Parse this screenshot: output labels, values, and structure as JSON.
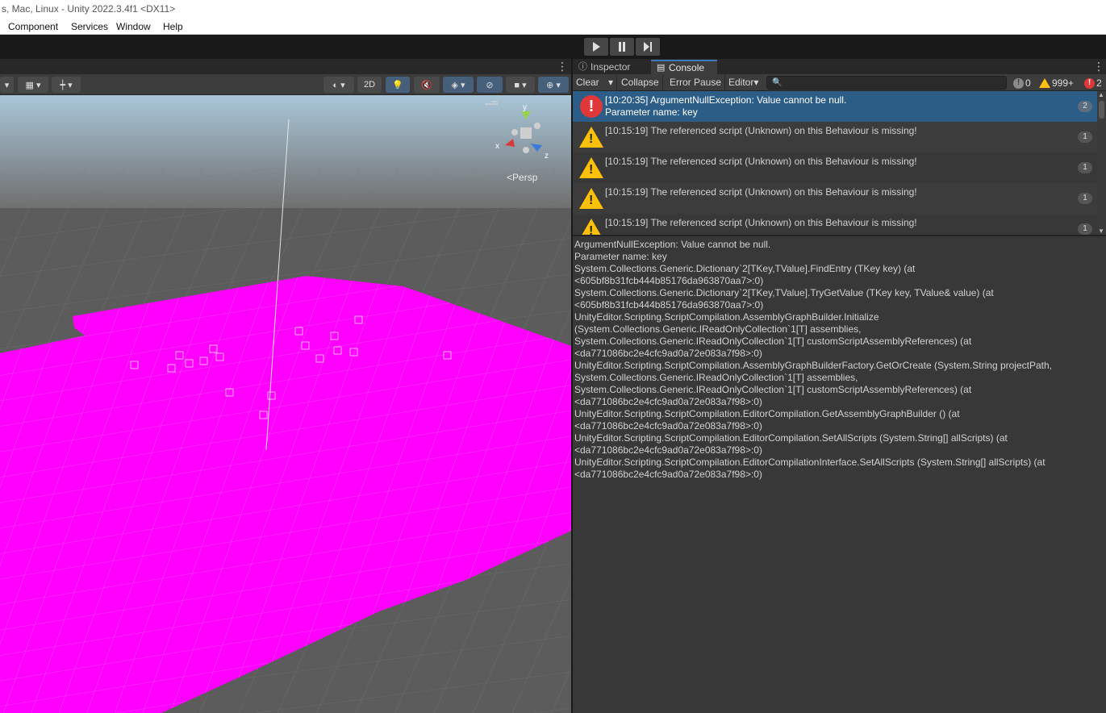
{
  "window": {
    "title": "s, Mac, Linux - Unity 2022.3.4f1 <DX11>"
  },
  "menu": {
    "items": [
      "Component",
      "Services",
      "Window",
      "Help"
    ]
  },
  "playbar": {
    "play_icon": "play-icon",
    "pause_icon": "pause-icon",
    "step_icon": "step-icon"
  },
  "scene": {
    "toolbar": {
      "mode_2d": "2D"
    },
    "gizmo": {
      "y": "y",
      "x": "x",
      "z": "z",
      "projection": "Persp"
    },
    "colors": {
      "ground": "#5c5c5c",
      "plane": "#ff00ff"
    }
  },
  "console_panel": {
    "tabs": [
      {
        "label": "Inspector",
        "icon": "info-icon"
      },
      {
        "label": "Console",
        "icon": "console-icon"
      }
    ],
    "toolbar": {
      "clear": "Clear",
      "collapse": "Collapse",
      "error_pause": "Error Pause",
      "editor": "Editor",
      "search_placeholder": "",
      "info_count": "0",
      "warning_count": "999+",
      "error_count": "2"
    },
    "entries": [
      {
        "type": "error",
        "line1": "[10:20:35] ArgumentNullException: Value cannot be null.",
        "line2": "Parameter name: key",
        "count": "2"
      },
      {
        "type": "warning",
        "line1": "[10:15:19] The referenced script (Unknown) on this Behaviour is missing!",
        "line2": "",
        "count": "1"
      },
      {
        "type": "warning",
        "line1": "[10:15:19] The referenced script (Unknown) on this Behaviour is missing!",
        "line2": "",
        "count": "1"
      },
      {
        "type": "warning",
        "line1": "[10:15:19] The referenced script (Unknown) on this Behaviour is missing!",
        "line2": "",
        "count": "1"
      },
      {
        "type": "warning",
        "line1": "[10:15:19] The referenced script (Unknown) on this Behaviour is missing!",
        "line2": "",
        "count": "1"
      }
    ],
    "detail": "ArgumentNullException: Value cannot be null.\nParameter name: key\nSystem.Collections.Generic.Dictionary`2[TKey,TValue].FindEntry (TKey key) (at\n<605bf8b31fcb444b85176da963870aa7>:0)\nSystem.Collections.Generic.Dictionary`2[TKey,TValue].TryGetValue (TKey key, TValue& value) (at\n<605bf8b31fcb444b85176da963870aa7>:0)\nUnityEditor.Scripting.ScriptCompilation.AssemblyGraphBuilder.Initialize\n(System.Collections.Generic.IReadOnlyCollection`1[T] assemblies,\nSystem.Collections.Generic.IReadOnlyCollection`1[T] customScriptAssemblyReferences) (at\n<da771086bc2e4cfc9ad0a72e083a7f98>:0)\nUnityEditor.Scripting.ScriptCompilation.AssemblyGraphBuilderFactory.GetOrCreate (System.String projectPath,\nSystem.Collections.Generic.IReadOnlyCollection`1[T] assemblies,\nSystem.Collections.Generic.IReadOnlyCollection`1[T] customScriptAssemblyReferences) (at\n<da771086bc2e4cfc9ad0a72e083a7f98>:0)\nUnityEditor.Scripting.ScriptCompilation.EditorCompilation.GetAssemblyGraphBuilder () (at\n<da771086bc2e4cfc9ad0a72e083a7f98>:0)\nUnityEditor.Scripting.ScriptCompilation.EditorCompilation.SetAllScripts (System.String[] allScripts) (at\n<da771086bc2e4cfc9ad0a72e083a7f98>:0)\nUnityEditor.Scripting.ScriptCompilation.EditorCompilationInterface.SetAllScripts (System.String[] allScripts) (at\n<da771086bc2e4cfc9ad0a72e083a7f98>:0)"
  }
}
